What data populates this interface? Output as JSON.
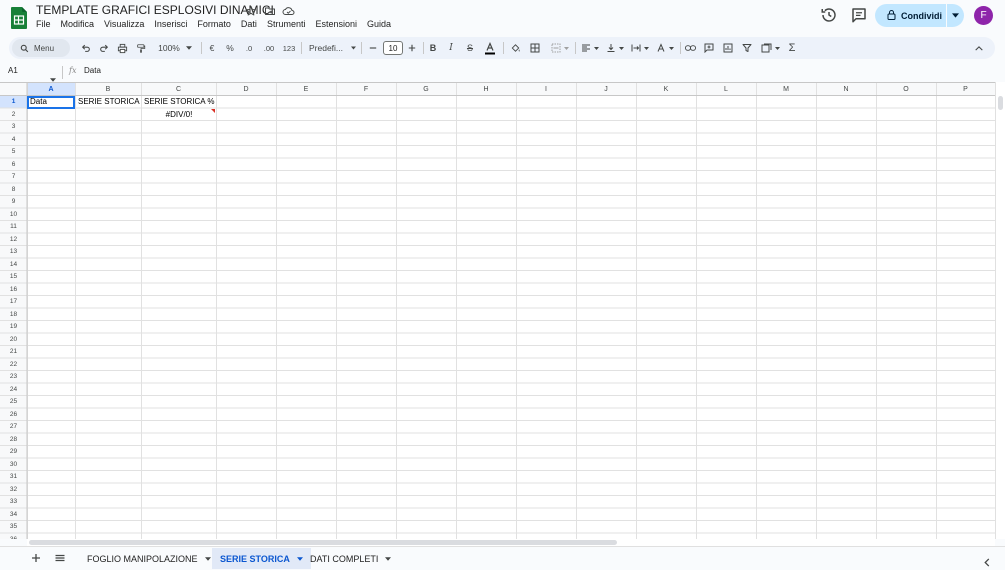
{
  "header": {
    "doc_title": "TEMPLATE GRAFICI ESPLOSIVI DINAMICI",
    "menu": [
      "File",
      "Modifica",
      "Visualizza",
      "Inserisci",
      "Formato",
      "Dati",
      "Strumenti",
      "Estensioni",
      "Guida"
    ],
    "share_label": "Condividi",
    "avatar_letter": "F"
  },
  "toolbar": {
    "menu_search": "Menu",
    "zoom": "100%",
    "currency": "€",
    "percent": "%",
    "decimal_decrease": ".0",
    "decimal_increase": ".00",
    "number_format": "123",
    "font_family": "Predefi...",
    "font_size": "10"
  },
  "formula_bar": {
    "name_box": "A1",
    "fx": "fx",
    "value": "Data"
  },
  "grid": {
    "columns": [
      "A",
      "B",
      "C",
      "D",
      "E",
      "F",
      "G",
      "H",
      "I",
      "J",
      "K",
      "L",
      "M",
      "N",
      "O",
      "P"
    ],
    "row_count": 36,
    "selected_column": "A",
    "selected_row": 1,
    "cells": {
      "A1": "Data",
      "B1": "SERIE STORICA",
      "C1": "SERIE STORICA %",
      "C2": "#DIV/0!"
    }
  },
  "sheets": {
    "tabs": [
      {
        "label": "FOGLIO MANIPOLAZIONE",
        "active": false
      },
      {
        "label": "SERIE STORICA",
        "active": true
      },
      {
        "label": "DATI COMPLETI",
        "active": false
      }
    ]
  },
  "colors": {
    "accent": "#0b57d0",
    "share_bg": "#c2e7ff",
    "avatar_bg": "#8e24aa",
    "logo_green": "#188038",
    "error": "#d93025"
  },
  "icons": {
    "logo": "sheets-logo-icon",
    "star": "star-icon",
    "folder": "move-folder-icon",
    "cloud": "cloud-status-icon",
    "history": "version-history-icon",
    "comments": "comments-icon",
    "lock": "lock-icon"
  }
}
